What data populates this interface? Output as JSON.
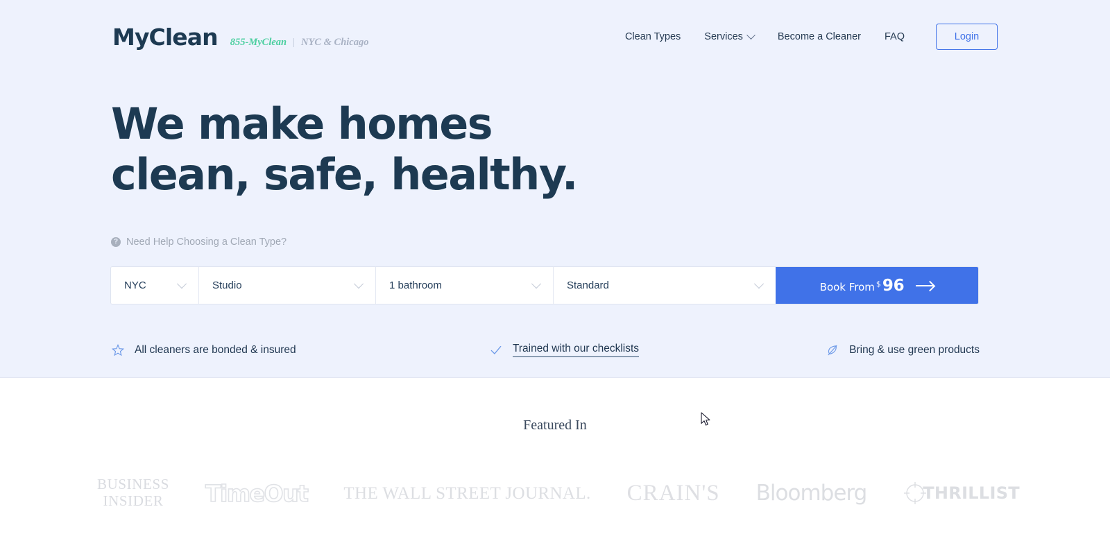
{
  "header": {
    "logo_text": "MyClean",
    "phone": "855-MyClean",
    "separator": "|",
    "cities": "NYC & Chicago",
    "nav_items": [
      {
        "label": "Clean Types",
        "has_dropdown": false
      },
      {
        "label": "Services",
        "has_dropdown": true
      },
      {
        "label": "Become a Cleaner",
        "has_dropdown": false
      },
      {
        "label": "FAQ",
        "has_dropdown": false
      }
    ],
    "login_label": "Login"
  },
  "hero": {
    "headline_line1": "We make homes",
    "headline_line2": "clean, safe, healthy.",
    "help_icon_glyph": "?",
    "help_text": "Need Help Choosing a Clean Type?",
    "background_color": "#eef2fd",
    "headline_color": "#1d3a52"
  },
  "booking_form": {
    "fields": [
      {
        "name": "location",
        "value": "NYC"
      },
      {
        "name": "home-size",
        "value": "Studio"
      },
      {
        "name": "bathrooms",
        "value": "1 bathroom"
      },
      {
        "name": "clean-type",
        "value": "Standard"
      }
    ],
    "cta": {
      "label": "Book From",
      "currency": "$",
      "price": "96",
      "arrow": "→",
      "color": "#4072e8"
    }
  },
  "features": [
    {
      "icon": "star-icon",
      "label": "All cleaners are bonded & insured",
      "is_link": false
    },
    {
      "icon": "check-icon",
      "label": "Trained with our checklists",
      "is_link": true
    },
    {
      "icon": "leaf-icon",
      "label": "Bring & use green products",
      "is_link": false
    }
  ],
  "featured": {
    "title": "Featured In",
    "logos": [
      {
        "name": "business-insider",
        "line1": "BUSINESS",
        "line2": "INSIDER"
      },
      {
        "name": "timeout",
        "text": "TimeOut"
      },
      {
        "name": "wall-street-journal",
        "text": "THE WALL STREET JOURNAL."
      },
      {
        "name": "crains",
        "text": "CRAIN'S"
      },
      {
        "name": "bloomberg",
        "text": "Bloomberg"
      },
      {
        "name": "thrillist",
        "text": "THRILLIST"
      }
    ]
  }
}
